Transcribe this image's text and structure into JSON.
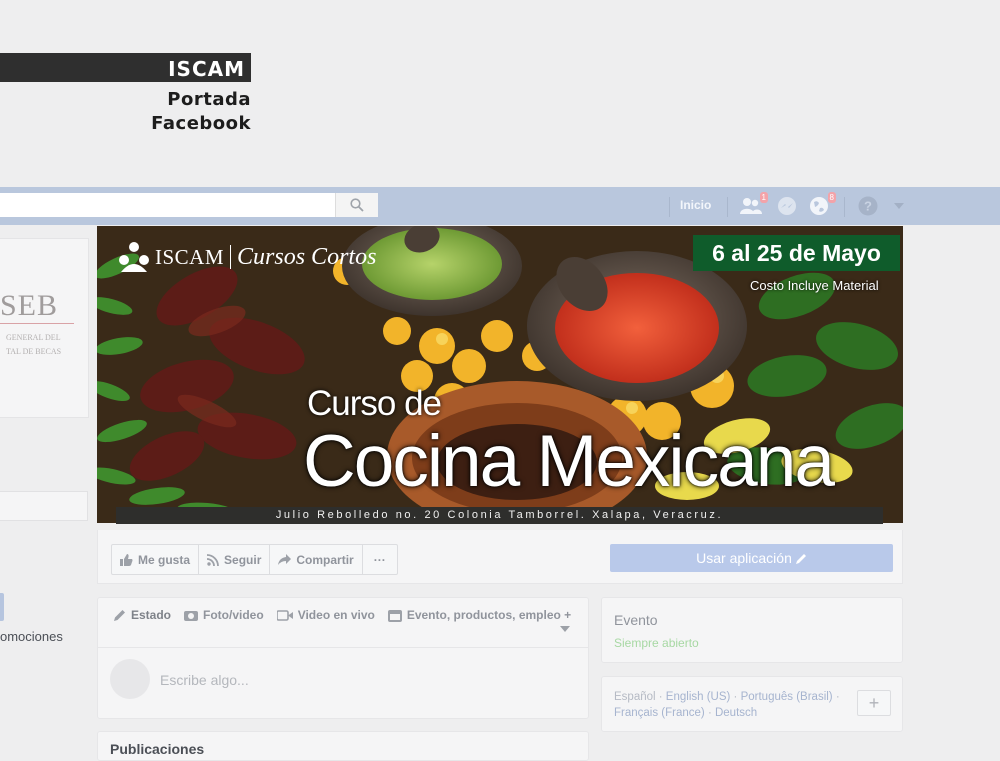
{
  "label": {
    "brand": "ISCAM",
    "subtitle_line1": "Portada",
    "subtitle_line2": "Facebook"
  },
  "topbar": {
    "search_placeholder": "",
    "home_label": "Inicio",
    "friends_badge": "1",
    "notifications_badge": "8",
    "icons": [
      "search-icon",
      "friend-requests-icon",
      "messages-icon",
      "notifications-globe-icon",
      "help-icon",
      "account-menu-caret-icon"
    ]
  },
  "left": {
    "logo_text": "SEB",
    "logo_sub_line1": "GENERAL DEL",
    "logo_sub_line2": "TAL DE BECAS",
    "promo_text": "omociones"
  },
  "cover": {
    "logo_org": "ISCAM",
    "logo_program": "Cursos Cortos",
    "dates": "6 al 25 de Mayo",
    "cost_note": "Costo Incluye Material",
    "course_prefix": "Curso de",
    "course_name": "Cocina Mexicana",
    "address": "Julio Rebolledo no. 20 Colonia Tamborrel. Xalapa, Veracruz."
  },
  "actions": {
    "like": "Me gusta",
    "follow": "Seguir",
    "share": "Compartir",
    "more": "···",
    "use_app": "Usar aplicación"
  },
  "composer": {
    "tabs": [
      "Estado",
      "Foto/video",
      "Video en vivo",
      "Evento, productos, empleo +"
    ],
    "placeholder": "Escribe algo..."
  },
  "publications": {
    "title": "Publicaciones"
  },
  "event": {
    "title": "Evento",
    "status": "Siempre abierto"
  },
  "languages": {
    "items": [
      "Español",
      "English (US)",
      "Português (Brasil)",
      "Français (France)",
      "Deutsch"
    ],
    "add_label": "+"
  },
  "colors": {
    "topbar": "#b9c7dd",
    "cover_date_box": "#0f5c2b",
    "use_app_button": "#b9c9ea",
    "event_status": "#a7d8a3"
  }
}
